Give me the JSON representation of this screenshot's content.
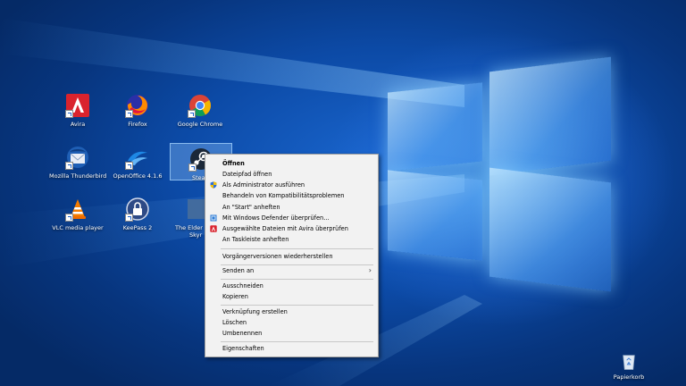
{
  "desktop": {
    "icons": [
      {
        "label": "Avira",
        "icon": "avira-icon"
      },
      {
        "label": "Firefox",
        "icon": "firefox-icon"
      },
      {
        "label": "Google Chrome",
        "icon": "chrome-icon"
      },
      {
        "label": "Mozilla Thunderbird",
        "icon": "thunderbird-icon"
      },
      {
        "label": "OpenOffice 4.1.6",
        "icon": "openoffice-icon"
      },
      {
        "label": "Steam",
        "icon": "steam-icon"
      },
      {
        "label": "VLC media player",
        "icon": "vlc-icon"
      },
      {
        "label": "KeePass 2",
        "icon": "keepass-icon"
      },
      {
        "label": "The Elder Scrolls V: Skyrim",
        "icon": "skyrim-icon"
      },
      {
        "label": "Papierkorb",
        "icon": "recycle-bin-icon"
      }
    ],
    "partial_labels": {
      "steam": "Stea",
      "skyrim_line1": "The Elder",
      "skyrim_line2": "Skyr"
    }
  },
  "context_menu": {
    "items": [
      {
        "label": "Öffnen",
        "bold": true
      },
      {
        "label": "Dateipfad öffnen"
      },
      {
        "label": "Als Administrator ausführen",
        "icon": "shield-icon"
      },
      {
        "label": "Behandeln von Kompatibilitätsproblemen"
      },
      {
        "label": "An \"Start\" anheften"
      },
      {
        "label": "Mit Windows Defender überprüfen...",
        "icon": "defender-icon"
      },
      {
        "label": "Ausgewählte Dateien mit Avira überprüfen",
        "icon": "avira-icon"
      },
      {
        "label": "An Taskleiste anheften"
      },
      {
        "label": "Vorgängerversionen wiederherstellen"
      },
      {
        "label": "Senden an",
        "submenu": true
      },
      {
        "label": "Ausschneiden"
      },
      {
        "label": "Kopieren"
      },
      {
        "label": "Verknüpfung erstellen"
      },
      {
        "label": "Löschen"
      },
      {
        "label": "Umbenennen"
      },
      {
        "label": "Eigenschaften"
      }
    ],
    "submenu_arrow": "›"
  },
  "colors": {
    "accent": "#0a3f8f",
    "menu_bg": "#f2f2f2",
    "avira_red": "#d9232d"
  }
}
